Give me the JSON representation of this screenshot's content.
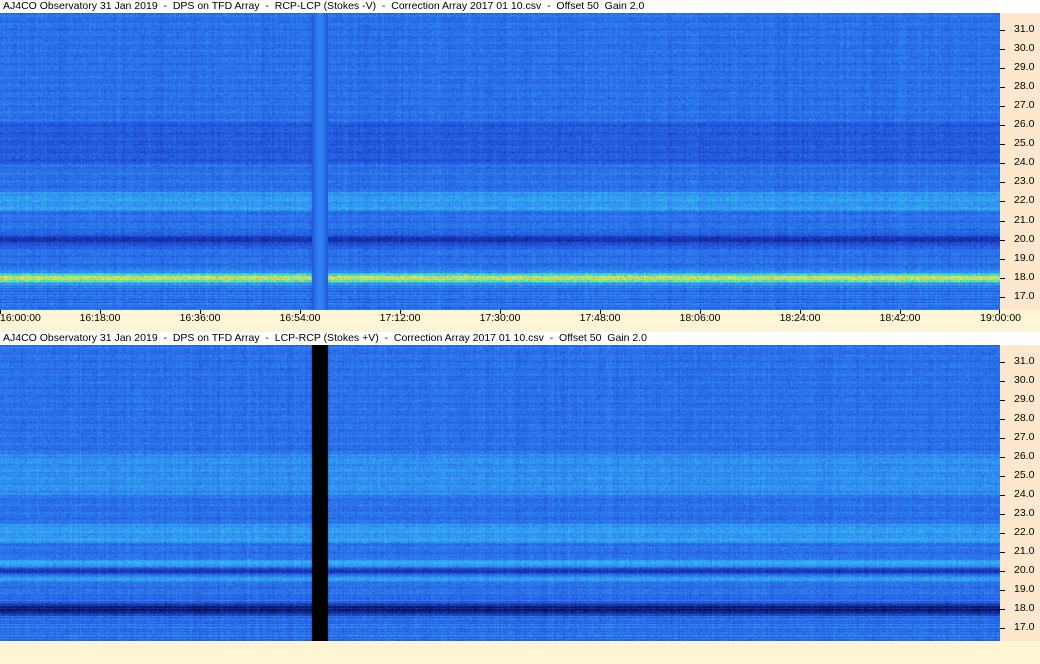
{
  "panels": [
    {
      "title": "AJ4CO Observatory 31 Jan 2019  -  DPS on TFD Array  -  RCP-LCP (Stokes -V)  -  Correction Array 2017 01 10.csv  -  Offset 50  Gain 2.0",
      "polarity": "RCP-LCP (Stokes -V)"
    },
    {
      "title": "AJ4CO Observatory 31 Jan 2019  -  DPS on TFD Array  -  LCP-RCP (Stokes +V)  -  Correction Array 2017 01 10.csv  -  Offset 50  Gain 2.0",
      "polarity": "LCP-RCP (Stokes +V)"
    }
  ],
  "chart_data": {
    "type": "heatmap",
    "x_axis": {
      "quantity": "UTC time",
      "range": [
        "16:00:00",
        "19:00:00"
      ],
      "ticks": [
        "16:00:00",
        "16:18:00",
        "16:36:00",
        "16:54:00",
        "17:12:00",
        "17:30:00",
        "17:48:00",
        "18:06:00",
        "18:24:00",
        "18:42:00",
        "19:00:00"
      ]
    },
    "y_axis": {
      "quantity": "frequency (MHz)",
      "range": [
        16.3,
        31.9
      ],
      "ticks": [
        31.0,
        30.0,
        29.0,
        28.0,
        27.0,
        26.0,
        25.0,
        24.0,
        23.0,
        22.0,
        21.0,
        20.0,
        19.0,
        18.0,
        17.0
      ],
      "tick_labels": [
        "31.0",
        "30.0",
        "29.0",
        "28.0",
        "27.0",
        "26.0",
        "25.0",
        "24.0",
        "23.0",
        "22.0",
        "21.0",
        "20.0",
        "19.0",
        "18.0",
        "17.0"
      ]
    },
    "colormap": [
      "#000000",
      "#10208a",
      "#1f4fd8",
      "#2f7ff0",
      "#35c0f0",
      "#58f0a8",
      "#e8f040",
      "#f0a030",
      "#e02020",
      "#ffffff"
    ],
    "data_gap": {
      "start": "16:56:00",
      "end": "16:59:00"
    },
    "panels": [
      {
        "name": "RCP-LCP (Stokes -V)",
        "bright_band_mhz": 18.0,
        "dark_band_mhz": 20.0
      },
      {
        "name": "LCP-RCP (Stokes +V)",
        "bright_band_mhz": 20.0,
        "dark_band_mhz": 18.0
      }
    ]
  }
}
